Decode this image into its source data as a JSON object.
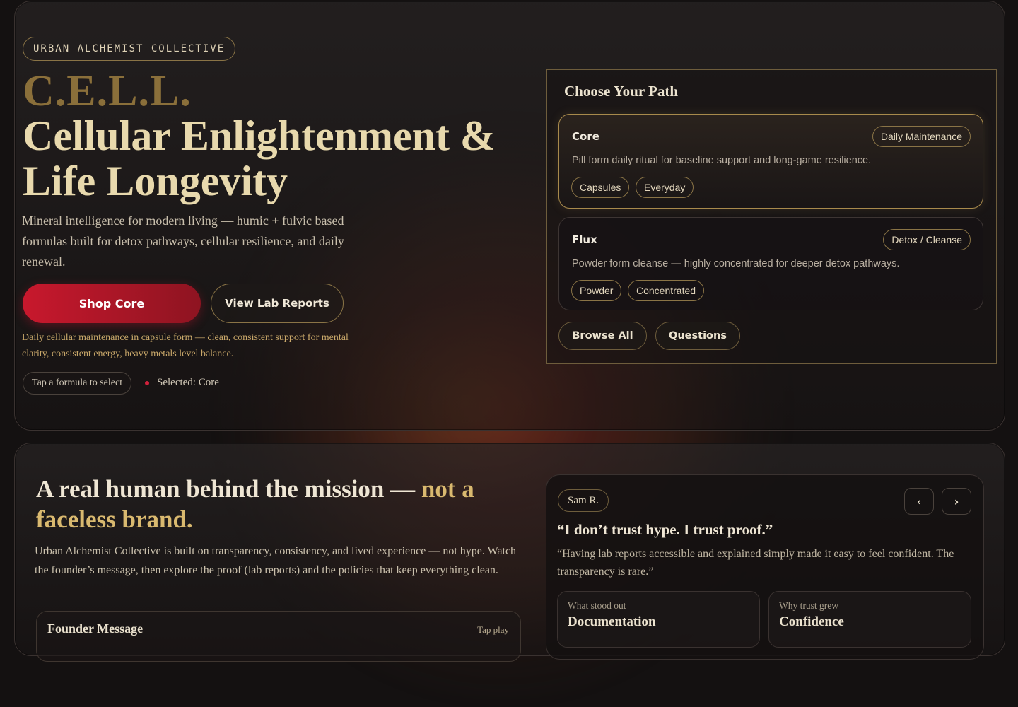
{
  "hero": {
    "brand_pill": "URBAN ALCHEMIST COLLECTIVE",
    "abbr": "C.E.L.L.",
    "title": "Cellular Enlightenment & Life Longevity",
    "subtitle": "Mineral intelligence for modern living — humic + fulvic based formulas built for detox pathways, cellular resilience, and daily renewal.",
    "primary_button": "Shop Core",
    "secondary_button": "View Lab Reports",
    "note": "Daily cellular maintenance in capsule form — clean, consistent support for mental clarity, consistent energy, heavy metals level balance.",
    "tap_hint": "Tap a formula to select",
    "selected": "Selected: Core"
  },
  "path": {
    "heading": "Choose Your Path",
    "cards": [
      {
        "title": "Core",
        "badge": "Daily Maintenance",
        "description": "Pill form daily ritual for baseline support and long-game resilience.",
        "tags": [
          "Capsules",
          "Everyday"
        ]
      },
      {
        "title": "Flux",
        "badge": "Detox / Cleanse",
        "description": "Powder form cleanse — highly concentrated for deeper detox pathways.",
        "tags": [
          "Powder",
          "Concentrated"
        ]
      }
    ],
    "browse_button": "Browse All",
    "questions_button": "Questions"
  },
  "mission": {
    "title_main": "A real human behind the mission — ",
    "title_accent": "not a faceless brand.",
    "body": "Urban Alchemist Collective is built on transparency, consistency, and lived experience — not hype. Watch the founder’s message, then explore the proof (lab reports) and the policies that keep everything clean.",
    "founder_title": "Founder Message",
    "founder_hint": "Tap play"
  },
  "testimonial": {
    "author": "Sam R.",
    "prev_icon": "‹",
    "next_icon": "›",
    "quote_title": "“I don’t trust hype. I trust proof.”",
    "quote_body": "“Having lab reports accessible and explained simply made it easy to feel confident. The transparency is rare.”",
    "stats": [
      {
        "label": "What stood out",
        "value": "Documentation"
      },
      {
        "label": "Why trust grew",
        "value": "Confidence"
      }
    ]
  },
  "colors": {
    "accent_gold": "#d9b96f",
    "primary_red": "#c8182d",
    "background": "#141111"
  }
}
